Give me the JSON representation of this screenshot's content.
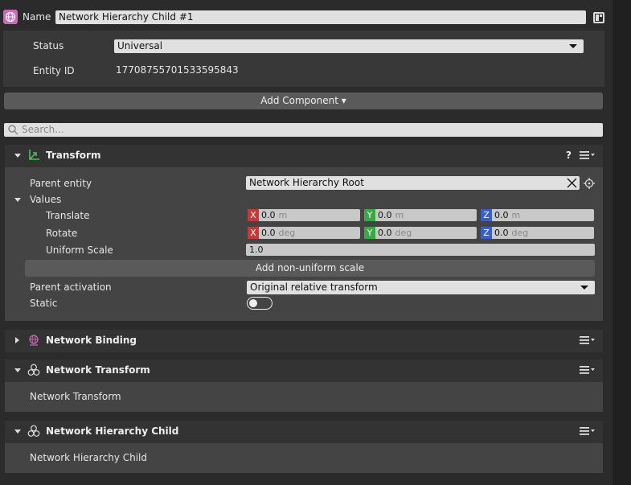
{
  "header": {
    "name_label": "Name",
    "name_value": "Network Hierarchy Child #1",
    "status_label": "Status",
    "status_value": "Universal",
    "entity_id_label": "Entity ID",
    "entity_id_value": "17708755701533595843"
  },
  "add_component_label": "Add Component ▾",
  "search": {
    "placeholder": "Search..."
  },
  "transform": {
    "title": "Transform",
    "help_label": "?",
    "parent_entity_label": "Parent entity",
    "parent_entity_value": "Network Hierarchy Root",
    "values_label": "Values",
    "translate_label": "Translate",
    "rotate_label": "Rotate",
    "uniform_scale_label": "Uniform Scale",
    "uniform_scale_value": "1.0",
    "translate": {
      "x": "0.0",
      "y": "0.0",
      "z": "0.0",
      "unit": "m"
    },
    "rotate": {
      "x": "0.0",
      "y": "0.0",
      "z": "0.0",
      "unit": "deg"
    },
    "axis_labels": {
      "x": "X",
      "y": "Y",
      "z": "Z"
    },
    "add_nonuniform_label": "Add non-uniform scale",
    "parent_activation_label": "Parent activation",
    "parent_activation_value": "Original relative transform",
    "static_label": "Static",
    "static_on": false
  },
  "network_binding": {
    "title": "Network Binding"
  },
  "network_transform": {
    "title": "Network Transform",
    "body_text": "Network Transform"
  },
  "network_hierarchy_child": {
    "title": "Network Hierarchy Child",
    "body_text": "Network Hierarchy Child"
  },
  "colors": {
    "axis_x": "#c43a3a",
    "axis_y": "#3aa844",
    "axis_z": "#3a5fcc",
    "entity_icon": "#c86bb8",
    "transform_icon": "#4cbf5a"
  }
}
